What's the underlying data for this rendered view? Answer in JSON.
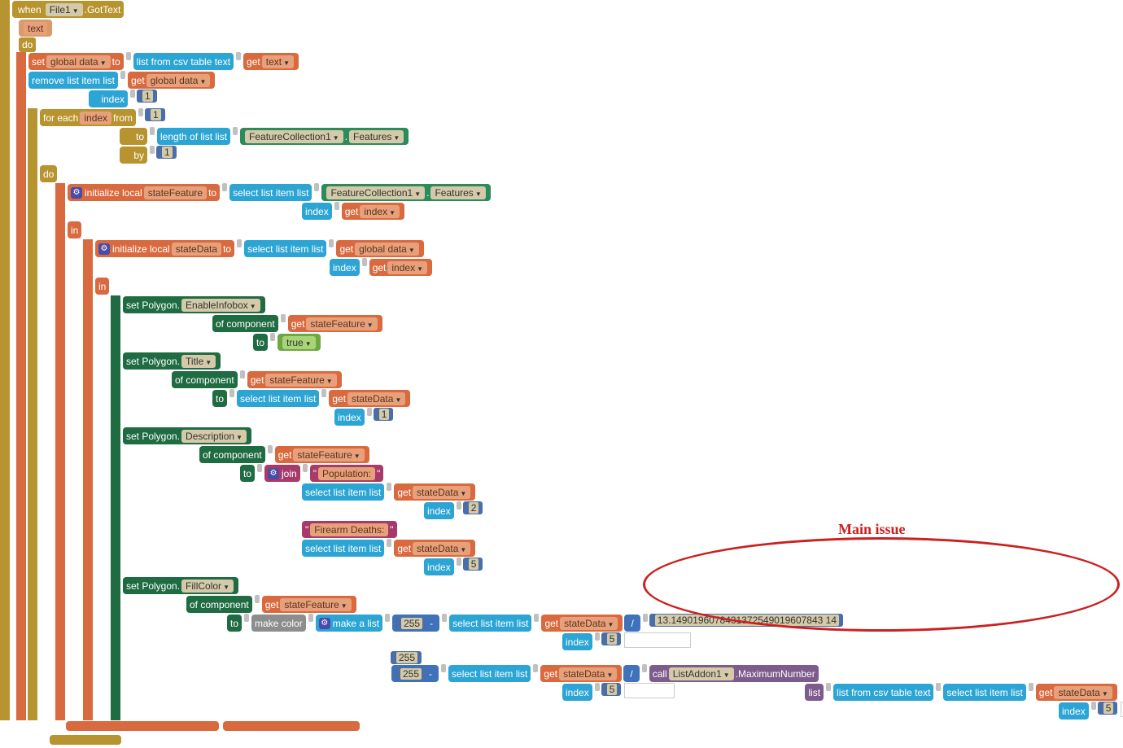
{
  "event": {
    "when": "when",
    "comp": "File1",
    "method": ".GotText",
    "param": "text"
  },
  "set1": {
    "set": "set",
    "var": "global data",
    "to": "to",
    "list": "list from csv table  text",
    "get": "get",
    "getvar": "text"
  },
  "remove": {
    "label": "remove list item  list",
    "get": "get",
    "var": "global data",
    "index": "index",
    "val": "1"
  },
  "foreach": {
    "label": "for each",
    "var": "index",
    "from": "from",
    "to": "to",
    "by": "by",
    "one": "1",
    "len": "length of list  list",
    "fc": "FeatureCollection1",
    "dot": ".",
    "feat": "Features"
  },
  "do": "do",
  "init1": {
    "label": "initialize local",
    "var": "stateFeature",
    "to": "to",
    "sel": "select list item  list",
    "fc": "FeatureCollection1",
    "dot": ".",
    "feat": "Features",
    "idx": "index",
    "get": "get",
    "gv": "index"
  },
  "in": "in",
  "init2": {
    "label": "initialize local",
    "var": "stateData",
    "to": "to",
    "sel": "select list item  list",
    "get": "get",
    "gv": "global data",
    "idx": "index",
    "iget": "get",
    "iv": "index"
  },
  "poly1": {
    "set": "set Polygon.",
    "prop": "EnableInfobox",
    "of": "of component",
    "get": "get",
    "gv": "stateFeature",
    "to": "to",
    "true": "true"
  },
  "poly2": {
    "set": "set Polygon.",
    "prop": "Title",
    "of": "of component",
    "get": "get",
    "gv": "stateFeature",
    "to": "to",
    "sel": "select list item  list",
    "sget": "get",
    "sv": "stateData",
    "idx": "index",
    "one": "1"
  },
  "poly3": {
    "set": "set Polygon.",
    "prop": "Description",
    "of": "of component",
    "get": "get",
    "gv": "stateFeature",
    "to": "to",
    "join": "join",
    "q1": "\"",
    "pop": "Population:",
    "sel": "select list item  list",
    "sget": "get",
    "sv": "stateData",
    "idx": "index",
    "two": "2",
    "fire": "Firearm Deaths:",
    "five": "5"
  },
  "poly4": {
    "set": "set Polygon.",
    "prop": "FillColor",
    "of": "of component",
    "get": "get",
    "gv": "stateFeature",
    "to": "to",
    "mc": "make color",
    "ml": "make a list",
    "n255": "255",
    "minus": "-",
    "sel": "select list item  list",
    "sget": "get",
    "sv": "stateData",
    "idx": "index",
    "five": "5",
    "div": "/",
    "bignum": "13.1490196078431372549019607843 14",
    "call": "call",
    "la": "ListAddon1",
    "mn": ".MaximumNumber",
    "list": "list",
    "csv": "list from csv table  text"
  },
  "annot": "Main issue"
}
